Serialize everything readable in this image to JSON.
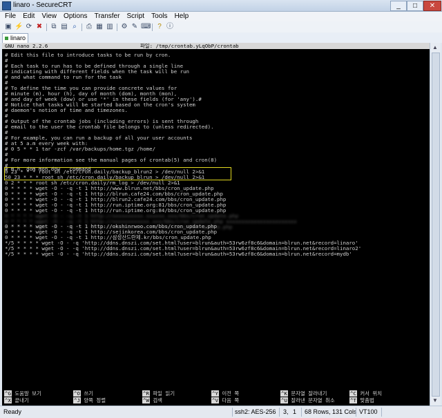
{
  "window": {
    "title": "linaro - SecureCRT"
  },
  "menu": [
    "File",
    "Edit",
    "View",
    "Options",
    "Transfer",
    "Script",
    "Tools",
    "Help"
  ],
  "toolbar": {
    "icons": [
      "connect-icon",
      "quick-connect-icon",
      "reconnect-icon",
      "disconnect-icon",
      "copy-icon",
      "paste-icon",
      "find-icon",
      "print-icon",
      "print-setup-icon",
      "log-icon",
      "session-options-icon",
      "global-options-icon",
      "keymap-icon",
      "help-icon",
      "about-icon"
    ]
  },
  "tab": {
    "label": "linaro"
  },
  "nano": {
    "version": "GNU nano 2.2.6",
    "file": "파일: /tmp/crontab.yLqObP/crontab"
  },
  "lines": [
    "# Edit this file to introduce tasks to be run by cron.",
    "#",
    "# Each task to run has to be defined through a single line",
    "# indicating with different fields when the task will be run",
    "# and what command to run for the task",
    "#",
    "# To define the time you can provide concrete values for",
    "# minute (m), hour (h), day of month (dom), month (mon),",
    "# and day of week (dow) or use '*' in these fields (for 'any').#",
    "# Notice that tasks will be started based on the cron's system",
    "# daemon's notion of time and timezones.",
    "#",
    "# Output of the crontab jobs (including errors) is sent through",
    "# email to the user the crontab file belongs to (unless redirected).",
    "#",
    "# For example, you can run a backup of all your user accounts",
    "# at 5 a.m every week with:",
    "# 0 5 * * 1 tar -zcf /var/backups/home.tgz /home/",
    "#",
    "# For more information see the manual pages of crontab(5) and cron(8)",
    "#",
    "# m h  dom mon dow   command",
    "0 23 * * * root sh /etc/cron.daily/backup_blrun2 > /dev/null 2>&1",
    "50 23 * * * root sh /etc/cron.daily/backup_blrun > /dev/null 2>&1",
    "0 2 * * * root sh /etc/cron.daily/rm_log > /dev/null 2>&1",
    "0 * * * * wget -O - -q -t 1 http://www.blrun.net/bbs/cron_update.php",
    "0 * * * * wget -O - -q -t 1 http://blrun.cafe24.com/bbs/cron_update.php",
    "0 * * * * wget -O - -q -t 1 http://blrun2.cafe24.com/bbs/cron_update.php",
    "0 * * * * wget -O - -q -t 1 http://run.iptime.org:81/bbs/cron_update.php",
    "0 * * * * wget -O - -q -t 1 http://run.iptime.org:84/bbs/cron_update.php"
  ],
  "lines2": [
    "0 * * * * wget -O - -q -t 1 http://okshinrwoo.com/bbs/cron_update.php",
    "0 * * * * wget -O - -q -t 1 http://sejinkorea.com/bbs/cron_update.php",
    "0 * * * * wget -O - -q -t 1 http://삼성산드란제.kr/bbs/cron_update.php",
    "*/5 * * * * wget -O - -q 'http://ddns.dnszi.com/set.html?user=blrun&auth=53rw6zf8c6&domain=blrun.net&record=linaro'",
    "*/5 * * * * wget -O - -q 'http://ddns.dnszi.com/set.html?user=blrun&auth=53rw6zf8c6&domain=blrun.net&record=linaro2'",
    "*/5 * * * * wget -O - -q 'http://ddns.dnszi.com/set.html?user=blrun&auth=53rw6zf8c6&domain=blrun.net&record=mydb'"
  ],
  "help": [
    {
      "key": "^G",
      "label": "도움말 보기"
    },
    {
      "key": "^O",
      "label": "쓰기"
    },
    {
      "key": "^R",
      "label": "파일 읽기"
    },
    {
      "key": "^Y",
      "label": "이전 쪽"
    },
    {
      "key": "^K",
      "label": "문자열 잘라내기"
    },
    {
      "key": "^C",
      "label": "커서 위치"
    },
    {
      "key": "^X",
      "label": "끝내기"
    },
    {
      "key": "^J",
      "label": "양쪽 정렬"
    },
    {
      "key": "^W",
      "label": "검색"
    },
    {
      "key": "^V",
      "label": "다음 쪽"
    },
    {
      "key": "^U",
      "label": "잘라낸 문자열 취소"
    },
    {
      "key": "^T",
      "label": "맞춤법"
    }
  ],
  "status": {
    "ready": "Ready",
    "cipher": "ssh2: AES-256",
    "row": "3,",
    "col": "1",
    "size": "68 Rows, 131 Cols",
    "term": "VT100"
  },
  "colors": {
    "highlight": "#e2d820",
    "terminal_bg": "#000000"
  }
}
